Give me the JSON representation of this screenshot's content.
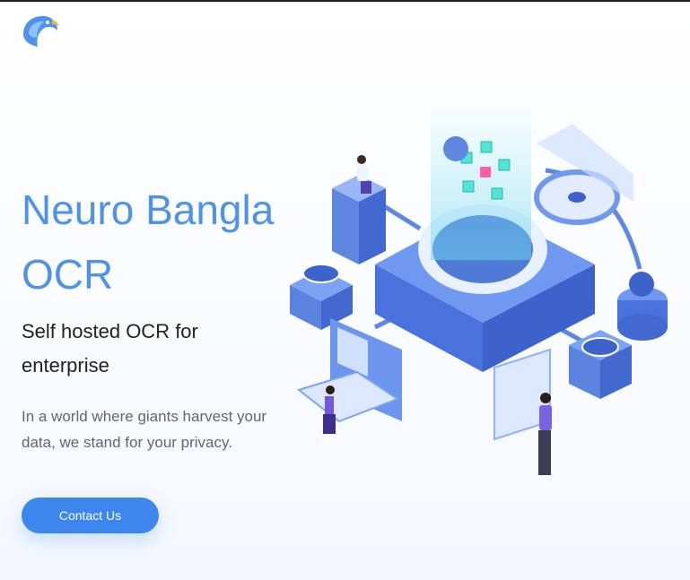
{
  "header": {
    "logo_icon": "eagle-head-icon"
  },
  "hero": {
    "title": "Neuro Bangla OCR",
    "subtitle": "Self hosted OCR for enterprise",
    "description": "In a world where giants harvest your data, we stand for your privacy.",
    "cta_label": "Contact Us"
  },
  "illustration": {
    "icon": "data-center-isometric-illustration"
  },
  "colors": {
    "accent": "#4f93e8",
    "button": "#3c86ee",
    "text_dark": "#222222",
    "text_muted": "#666666"
  }
}
